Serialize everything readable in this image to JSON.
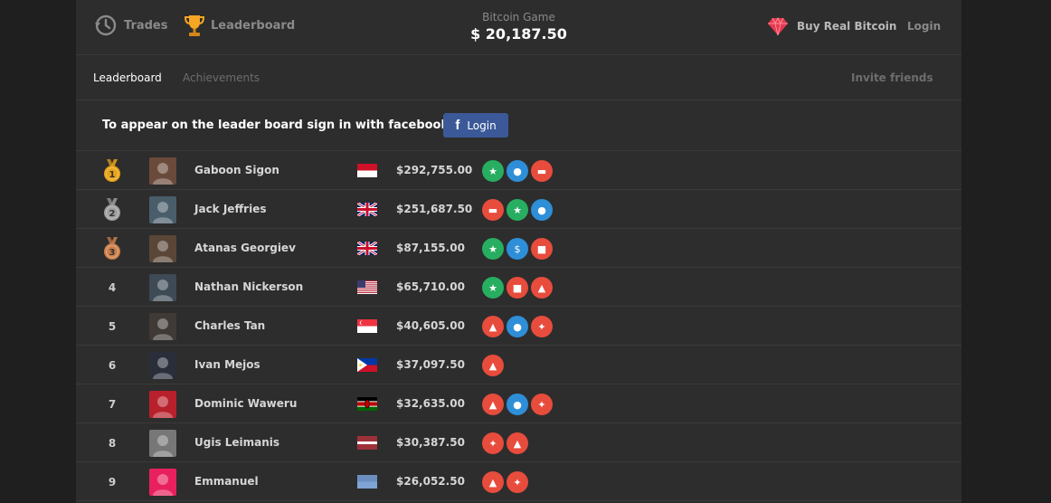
{
  "topbar": {
    "trades_label": "Trades",
    "leaderboard_label": "Leaderboard",
    "app_title": "Bitcoin Game",
    "balance": "$ 20,187.50",
    "buy_label": "Buy Real Bitcoin",
    "login_label": "Login"
  },
  "subnav": {
    "tabs": [
      {
        "label": "Leaderboard",
        "active": true
      },
      {
        "label": "Achievements",
        "active": false
      }
    ],
    "invite_label": "Invite friends"
  },
  "facebook": {
    "prompt": "To appear on the leader board sign in with facebook",
    "button_label": "Login"
  },
  "colors": {
    "background": "#2d2d2d",
    "facebook": "#3b5998",
    "badge_red": "#e74c3c",
    "badge_green": "#27ae60",
    "badge_blue": "#2e8fd8",
    "gold": "#e8a317",
    "silver": "#9e9e9e",
    "bronze": "#cd7f4a"
  },
  "players": [
    {
      "rank": "1",
      "medal": "gold",
      "name": "Gaboon Sigon",
      "flag": "indonesia",
      "amount": "$292,755.00",
      "badges": [
        "green-medal-icon",
        "blue-trophy-icon",
        "red-chart-icon"
      ]
    },
    {
      "rank": "2",
      "medal": "silver",
      "name": "Jack Jeffries",
      "flag": "uk",
      "amount": "$251,687.50",
      "badges": [
        "red-chart-icon",
        "green-medal-icon",
        "blue-trophy-icon"
      ]
    },
    {
      "rank": "3",
      "medal": "bronze",
      "name": "Atanas Georgiev",
      "flag": "uk",
      "amount": "$87,155.00",
      "badges": [
        "green-medal-icon",
        "blue-moneybag-icon",
        "red-coins-icon"
      ]
    },
    {
      "rank": "4",
      "medal": "",
      "name": "Nathan Nickerson",
      "flag": "usa",
      "amount": "$65,710.00",
      "badges": [
        "green-medal-icon",
        "red-coins-icon",
        "red-flame-icon"
      ]
    },
    {
      "rank": "5",
      "medal": "",
      "name": "Charles Tan",
      "flag": "singapore",
      "amount": "$40,605.00",
      "badges": [
        "red-flame-icon",
        "blue-sun-icon",
        "red-rocket-icon"
      ]
    },
    {
      "rank": "6",
      "medal": "",
      "name": "Ivan Mejos",
      "flag": "philippines",
      "amount": "$37,097.50",
      "badges": [
        "red-flame-icon"
      ]
    },
    {
      "rank": "7",
      "medal": "",
      "name": "Dominic Waweru",
      "flag": "kenya",
      "amount": "$32,635.00",
      "badges": [
        "red-flame-icon",
        "blue-sun-icon",
        "red-rocket-icon"
      ]
    },
    {
      "rank": "8",
      "medal": "",
      "name": "Ugis Leimanis",
      "flag": "latvia",
      "amount": "$30,387.50",
      "badges": [
        "red-rocket-icon",
        "red-flame-icon"
      ]
    },
    {
      "rank": "9",
      "medal": "",
      "name": "Emmanuel",
      "flag": "unknown",
      "amount": "$26,052.50",
      "badges": [
        "red-flame-icon",
        "red-rocket-icon"
      ]
    }
  ]
}
